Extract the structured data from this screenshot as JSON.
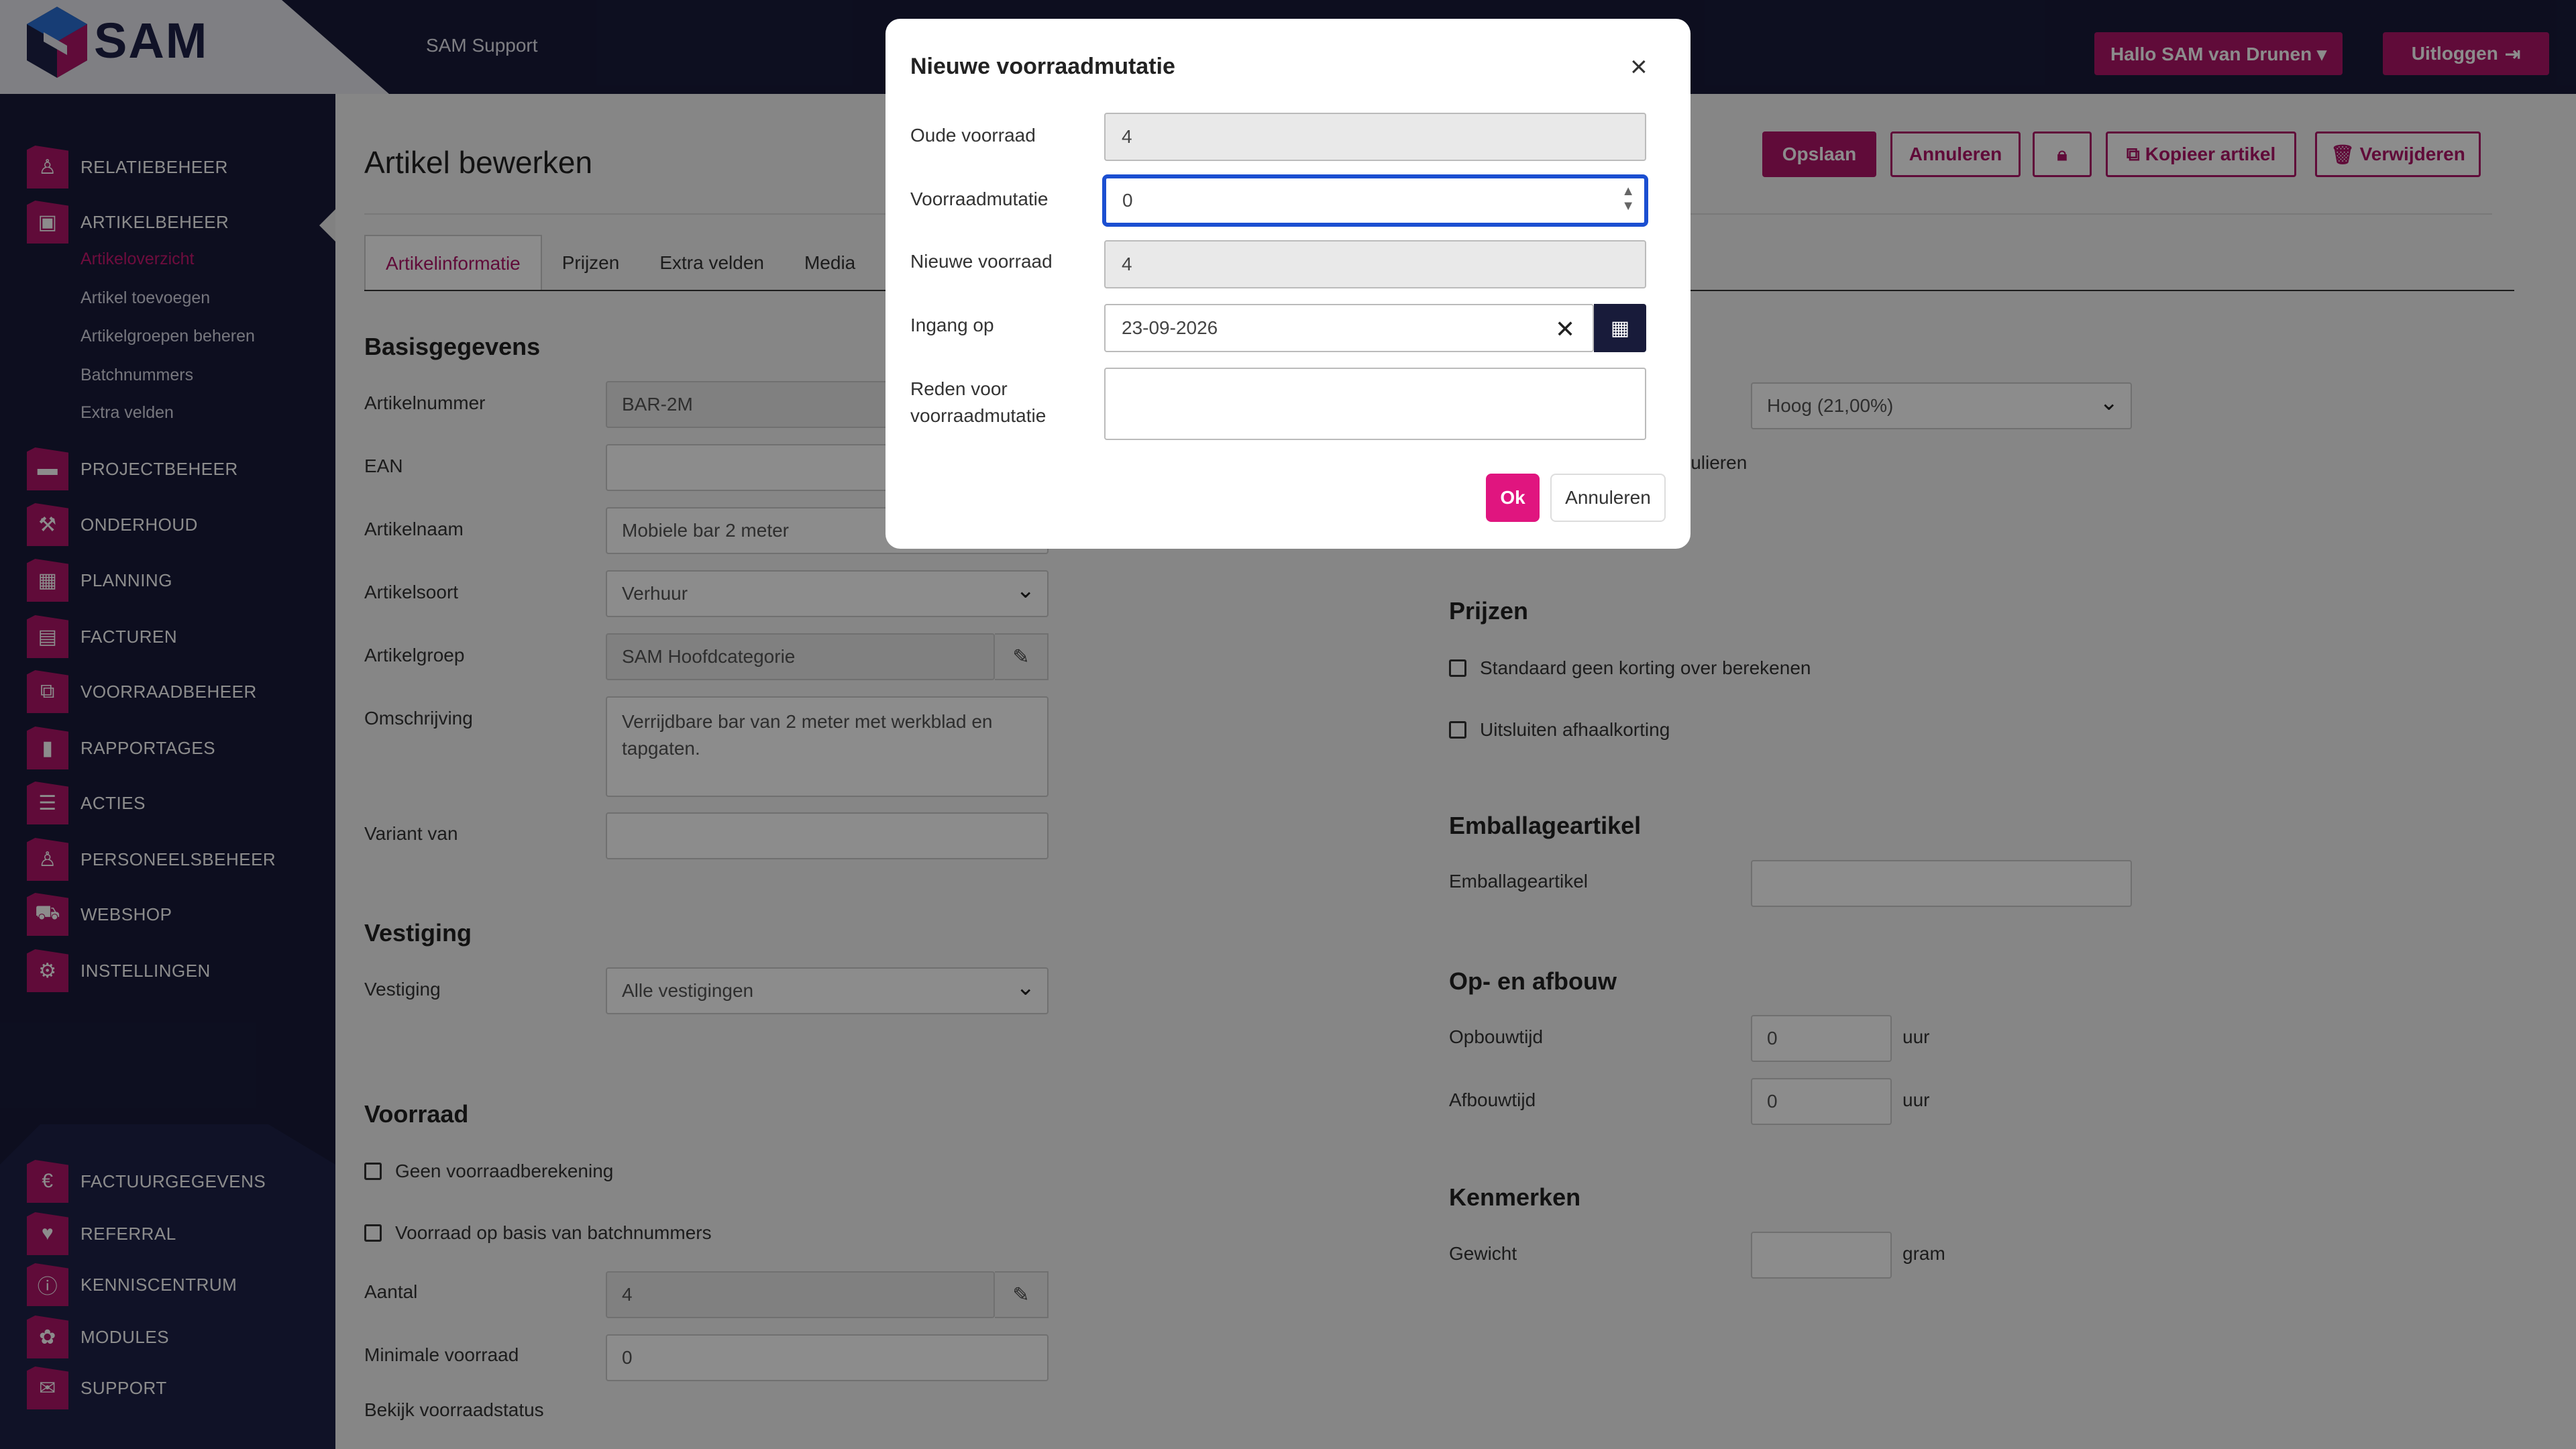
{
  "app": {
    "logo_text": "SAM",
    "support_link": "SAM Support"
  },
  "topbar": {
    "user_menu": "Hallo SAM van Drunen ▾",
    "logout": "Uitloggen"
  },
  "sidebar": {
    "items": [
      {
        "label": "RELATIEBEHEER",
        "icon": "user-icon"
      },
      {
        "label": "ARTIKELBEHEER",
        "icon": "box-icon"
      },
      {
        "label": "PROJECTBEHEER",
        "icon": "folder-icon"
      },
      {
        "label": "ONDERHOUD",
        "icon": "wrench-icon"
      },
      {
        "label": "PLANNING",
        "icon": "calendar-icon"
      },
      {
        "label": "FACTUREN",
        "icon": "invoice-icon"
      },
      {
        "label": "VOORRAADBEHEER",
        "icon": "boxes-icon"
      },
      {
        "label": "RAPPORTAGES",
        "icon": "chart-icon"
      },
      {
        "label": "ACTIES",
        "icon": "checklist-icon"
      },
      {
        "label": "PERSONEELSBEHEER",
        "icon": "person-icon"
      },
      {
        "label": "WEBSHOP",
        "icon": "cart-icon"
      },
      {
        "label": "INSTELLINGEN",
        "icon": "gear-icon"
      }
    ],
    "subitems": [
      "Artikeloverzicht",
      "Artikel toevoegen",
      "Artikelgroepen beheren",
      "Batchnummers",
      "Extra velden"
    ],
    "bottom_items": [
      {
        "label": "FACTUURGEGEVENS",
        "icon": "billing-icon"
      },
      {
        "label": "REFERRAL",
        "icon": "heart-icon"
      },
      {
        "label": "KENNISCENTRUM",
        "icon": "info-icon"
      },
      {
        "label": "MODULES",
        "icon": "modules-icon"
      },
      {
        "label": "SUPPORT",
        "icon": "ticket-icon"
      }
    ]
  },
  "page": {
    "title": "Artikel bewerken"
  },
  "actions": {
    "save": "Opslaan",
    "cancel": "Annuleren",
    "copy": "Kopieer artikel",
    "delete": "Verwijderen"
  },
  "tabs": [
    "Artikelinformatie",
    "Prijzen",
    "Extra velden",
    "Media"
  ],
  "basis": {
    "heading": "Basisgegevens",
    "artikelnummer_label": "Artikelnummer",
    "artikelnummer_value": "BAR-2M",
    "ean_label": "EAN",
    "ean_value": "",
    "artikelnaam_label": "Artikelnaam",
    "artikelnaam_value": "Mobiele bar 2 meter",
    "artikelsoort_label": "Artikelsoort",
    "artikelsoort_value": "Verhuur",
    "artikelgroep_label": "Artikelgroep",
    "artikelgroep_value": "SAM Hoofdcategorie",
    "omschrijving_label": "Omschrijving",
    "omschrijving_value": "Verrijdbare bar van 2 meter met werkblad en tapgaten.",
    "variant_label": "Variant van",
    "variant_value": ""
  },
  "vestiging": {
    "heading": "Vestiging",
    "label": "Vestiging",
    "value": "Alle vestigingen"
  },
  "voorraad": {
    "heading": "Voorraad",
    "no_calc": "Geen voorraadberekening",
    "batch_based": "Voorraad op basis van batchnummers",
    "aantal_label": "Aantal",
    "aantal_value": "4",
    "min_label": "Minimale voorraad",
    "min_value": "0",
    "status_link": "Bekijk voorraadstatus"
  },
  "right": {
    "btw_value": "Hoog (21,00%)",
    "particulieren_fragment": "iculieren",
    "prijzen_heading": "Prijzen",
    "no_discount": "Standaard geen korting over berekenen",
    "exclude_pickup": "Uitsluiten afhaalkorting",
    "emballage_heading": "Emballageartikel",
    "emballage_label": "Emballageartikel",
    "emballage_value": "",
    "opaf_heading": "Op- en afbouw",
    "opbouw_label": "Opbouwtijd",
    "opbouw_value": "0",
    "afbouw_label": "Afbouwtijd",
    "afbouw_value": "0",
    "unit_hours": "uur",
    "kenmerken_heading": "Kenmerken",
    "gewicht_label": "Gewicht",
    "gewicht_value": "",
    "unit_gram": "gram"
  },
  "modal": {
    "title": "Nieuwe voorraadmutatie",
    "oude_label": "Oude voorraad",
    "oude_value": "4",
    "mutatie_label": "Voorraadmutatie",
    "mutatie_value": "0",
    "nieuwe_label": "Nieuwe voorraad",
    "nieuwe_value": "4",
    "ingang_label": "Ingang op",
    "ingang_value": "23-09-2026",
    "reden_label_1": "Reden voor",
    "reden_label_2": "voorraadmutatie",
    "reden_value": "",
    "ok": "Ok",
    "cancel": "Annuleren"
  },
  "colors": {
    "brand": "#b01468",
    "navy": "#181b3a",
    "focus": "#1b4fd1",
    "ok_button": "#e0157f"
  }
}
